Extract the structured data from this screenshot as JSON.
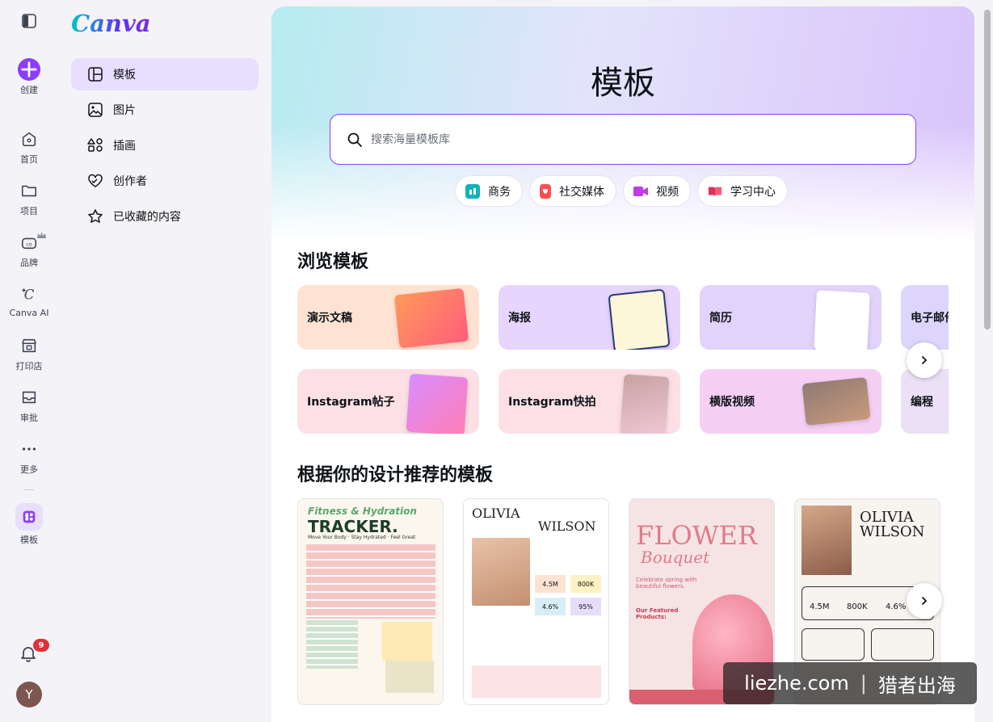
{
  "rail": {
    "create": "创建",
    "home": "首页",
    "projects": "项目",
    "brand": "品牌",
    "canva_ai": "Canva AI",
    "print": "打印店",
    "approval": "审批",
    "more": "更多",
    "templates": "模板",
    "notifications_count": "9",
    "avatar_initial": "Y"
  },
  "logo": "Canva",
  "panel": {
    "items": [
      {
        "label": "模板"
      },
      {
        "label": "图片"
      },
      {
        "label": "插画"
      },
      {
        "label": "创作者"
      },
      {
        "label": "已收藏的内容"
      }
    ]
  },
  "hero": {
    "title": "模板",
    "search_placeholder": "搜索海量模板库",
    "chips": [
      {
        "label": "商务",
        "color": "#13b3b9"
      },
      {
        "label": "社交媒体",
        "color": "#ff4d4f"
      },
      {
        "label": "视频",
        "color": "#c13ce6"
      },
      {
        "label": "学习中心",
        "color": "#e0305a"
      }
    ]
  },
  "browse": {
    "title": "浏览模板",
    "row1": [
      "演示文稿",
      "海报",
      "简历",
      "电子邮件"
    ],
    "row2": [
      "Instagram帖子",
      "Instagram快拍",
      "横版视频",
      "编程"
    ]
  },
  "recommended": {
    "title": "根据你的设计推荐的模板",
    "templates": [
      {
        "heading": "Fitness & Hydration",
        "sub": "TRACKER.",
        "tagline": "Move Your Body · Stay Hydrated · Feel Great"
      },
      {
        "heading": "OLIVIA",
        "sub": "WILSON",
        "stats": [
          "4.5M",
          "800K",
          "4.6%",
          "95%"
        ]
      },
      {
        "heading": "FLOWER",
        "sub": "Bouquet",
        "tagline": "Celebrate spring with beautiful flowers.",
        "featured": "Our Featured Products:"
      },
      {
        "heading": "OLIVIA",
        "sub": "WILSON",
        "stats": [
          "4.5M",
          "800K",
          "4.6%"
        ]
      }
    ]
  },
  "watermark": {
    "left": "liezhe.com",
    "sep": "|",
    "right": "猎者出海"
  }
}
